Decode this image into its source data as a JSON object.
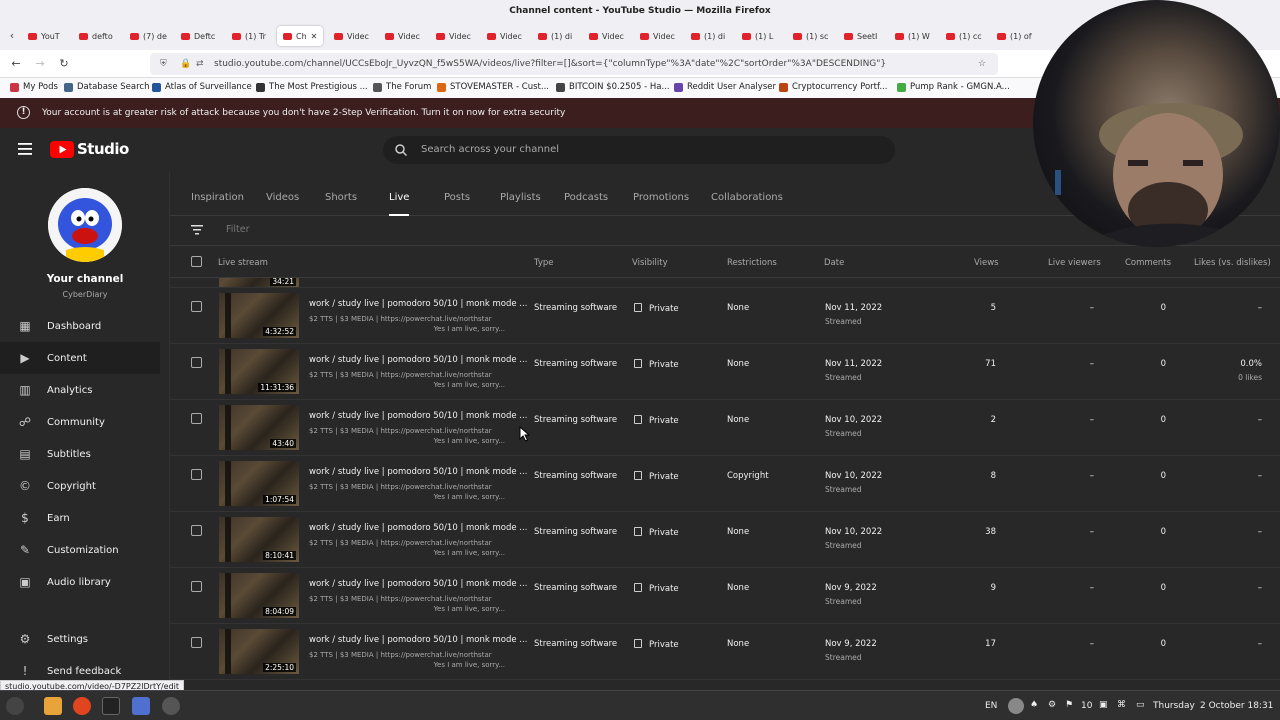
{
  "window": {
    "title": "Channel content - YouTube Studio — Mozilla Firefox"
  },
  "browser_tabs": [
    {
      "label": "YouT"
    },
    {
      "label": "defto"
    },
    {
      "label": "(7) de"
    },
    {
      "label": "Deftc"
    },
    {
      "label": "(1) Tr"
    },
    {
      "label": "Ch",
      "active": true
    },
    {
      "label": "Videc"
    },
    {
      "label": "Videc"
    },
    {
      "label": "Videc"
    },
    {
      "label": "Videc"
    },
    {
      "label": "(1) di"
    },
    {
      "label": "Videc"
    },
    {
      "label": "Videc"
    },
    {
      "label": "(1) di"
    },
    {
      "label": "(1) L"
    },
    {
      "label": "(1) sc"
    },
    {
      "label": "SeetI"
    },
    {
      "label": "(1) W"
    },
    {
      "label": "(1) cc"
    },
    {
      "label": "(1) of"
    }
  ],
  "url": "studio.youtube.com/channel/UCCsEboJr_UyvzQN_f5wS5WA/videos/live?filter=[]&sort={\"columnType\"%3A\"date\"%2C\"sortOrder\"%3A\"DESCENDING\"}",
  "bookmarks": [
    {
      "label": "My Pods",
      "color": "#cc3344"
    },
    {
      "label": "Database Search",
      "color": "#446688"
    },
    {
      "label": "Atlas of Surveillance",
      "color": "#225599"
    },
    {
      "label": "The Most Prestigious ...",
      "color": "#333333"
    },
    {
      "label": "The Forum",
      "color": "#555555"
    },
    {
      "label": "STOVEMASTER - Cust...",
      "color": "#dd6611"
    },
    {
      "label": "BITCOIN $0.2505 - Ha...",
      "color": "#444444"
    },
    {
      "label": "Reddit User Analyser",
      "color": "#6644aa"
    },
    {
      "label": "Cryptocurrency Portf...",
      "color": "#bb4411"
    },
    {
      "label": "Pump Rank - GMGN.A...",
      "color": "#44aa44"
    }
  ],
  "banner": {
    "text": "Your account is at greater risk of attack because you don't have 2-Step Verification. Turn it on now for extra security"
  },
  "studio": {
    "logo": "Studio",
    "search_placeholder": "Search across your channel"
  },
  "channel": {
    "heading": "Your channel",
    "name": "CyberDiary"
  },
  "nav": [
    {
      "label": "Dashboard",
      "icon": "dashboard-icon",
      "glyph": "▦"
    },
    {
      "label": "Content",
      "icon": "content-icon",
      "glyph": "▶",
      "active": true
    },
    {
      "label": "Analytics",
      "icon": "analytics-icon",
      "glyph": "▥"
    },
    {
      "label": "Community",
      "icon": "community-icon",
      "glyph": "☍"
    },
    {
      "label": "Subtitles",
      "icon": "subtitles-icon",
      "glyph": "▤"
    },
    {
      "label": "Copyright",
      "icon": "copyright-icon",
      "glyph": "©"
    },
    {
      "label": "Earn",
      "icon": "earn-icon",
      "glyph": "$"
    },
    {
      "label": "Customization",
      "icon": "customization-icon",
      "glyph": "✎"
    },
    {
      "label": "Audio library",
      "icon": "audio-library-icon",
      "glyph": "▣"
    }
  ],
  "nav_bottom": [
    {
      "label": "Settings",
      "icon": "settings-icon",
      "glyph": "⚙"
    },
    {
      "label": "Send feedback",
      "icon": "feedback-icon",
      "glyph": "!"
    }
  ],
  "content_tabs": [
    {
      "label": "Inspiration"
    },
    {
      "label": "Videos"
    },
    {
      "label": "Shorts"
    },
    {
      "label": "Live",
      "active": true
    },
    {
      "label": "Posts"
    },
    {
      "label": "Playlists"
    },
    {
      "label": "Podcasts"
    },
    {
      "label": "Promotions"
    },
    {
      "label": "Collaborations"
    }
  ],
  "filter_placeholder": "Filter",
  "columns": {
    "live_stream": "Live stream",
    "type": "Type",
    "visibility": "Visibility",
    "restrictions": "Restrictions",
    "date": "Date",
    "views": "Views",
    "live_viewers": "Live viewers",
    "comments": "Comments",
    "likes": "Likes (vs. dislikes)"
  },
  "top_partial_duration": "34:21",
  "rows": [
    {
      "duration": "4:32:52",
      "title": "work / study live | pomodoro 50/10 | monk mode ...",
      "desc1": "$2 TTS | $3 MEDIA | https://powerchat.live/northstar",
      "desc2": "Yes I am live, sorry...",
      "type": "Streaming software",
      "visibility": "Private",
      "restrictions": "None",
      "date": "Nov 11, 2022",
      "date_sub": "Streamed",
      "views": "5",
      "live_viewers": "–",
      "comments": "0",
      "likes": "–",
      "likes_sub": ""
    },
    {
      "duration": "11:31:36",
      "title": "work / study live | pomodoro 50/10 | monk mode ...",
      "desc1": "$2 TTS | $3 MEDIA | https://powerchat.live/northstar",
      "desc2": "Yes I am live, sorry...",
      "type": "Streaming software",
      "visibility": "Private",
      "restrictions": "None",
      "date": "Nov 11, 2022",
      "date_sub": "Streamed",
      "views": "71",
      "live_viewers": "–",
      "comments": "0",
      "likes": "0.0%",
      "likes_sub": "0 likes"
    },
    {
      "duration": "43:40",
      "title": "work / study live | pomodoro 50/10 | monk mode ...",
      "desc1": "$2 TTS | $3 MEDIA | https://powerchat.live/northstar",
      "desc2": "Yes I am live, sorry...",
      "type": "Streaming software",
      "visibility": "Private",
      "restrictions": "None",
      "date": "Nov 10, 2022",
      "date_sub": "Streamed",
      "views": "2",
      "live_viewers": "–",
      "comments": "0",
      "likes": "–",
      "likes_sub": ""
    },
    {
      "duration": "1:07:54",
      "title": "work / study live | pomodoro 50/10 | monk mode ...",
      "desc1": "$2 TTS | $3 MEDIA | https://powerchat.live/northstar",
      "desc2": "Yes I am live, sorry...",
      "type": "Streaming software",
      "visibility": "Private",
      "restrictions": "Copyright",
      "date": "Nov 10, 2022",
      "date_sub": "Streamed",
      "views": "8",
      "live_viewers": "–",
      "comments": "0",
      "likes": "–",
      "likes_sub": ""
    },
    {
      "duration": "8:10:41",
      "title": "work / study live | pomodoro 50/10 | monk mode ...",
      "desc1": "$2 TTS | $3 MEDIA | https://powerchat.live/northstar",
      "desc2": "Yes I am live, sorry...",
      "type": "Streaming software",
      "visibility": "Private",
      "restrictions": "None",
      "date": "Nov 10, 2022",
      "date_sub": "Streamed",
      "views": "38",
      "live_viewers": "–",
      "comments": "0",
      "likes": "–",
      "likes_sub": ""
    },
    {
      "duration": "8:04:09",
      "title": "work / study live | pomodoro 50/10 | monk mode ...",
      "desc1": "$2 TTS | $3 MEDIA | https://powerchat.live/northstar",
      "desc2": "Yes I am live, sorry...",
      "type": "Streaming software",
      "visibility": "Private",
      "restrictions": "None",
      "date": "Nov 9, 2022",
      "date_sub": "Streamed",
      "views": "9",
      "live_viewers": "–",
      "comments": "0",
      "likes": "–",
      "likes_sub": ""
    },
    {
      "duration": "2:25:10",
      "title": "work / study live | pomodoro 50/10 | monk mode ...",
      "desc1": "$2 TTS | $3 MEDIA | https://powerchat.live/northstar",
      "desc2": "Yes I am live, sorry...",
      "type": "Streaming software",
      "visibility": "Private",
      "restrictions": "None",
      "date": "Nov 9, 2022",
      "date_sub": "Streamed",
      "views": "17",
      "live_viewers": "–",
      "comments": "0",
      "likes": "–",
      "likes_sub": ""
    }
  ],
  "status_url": "studio.youtube.com/video/-D7PZ2lDrtY/edit",
  "taskbar": {
    "lang": "EN",
    "volume": "10",
    "day": "Thursday",
    "datetime": "2 October 18:31"
  },
  "colors": {
    "brand_red": "#ff0000",
    "studio_bg": "#282828",
    "banner_bg": "#3c1e1e"
  }
}
